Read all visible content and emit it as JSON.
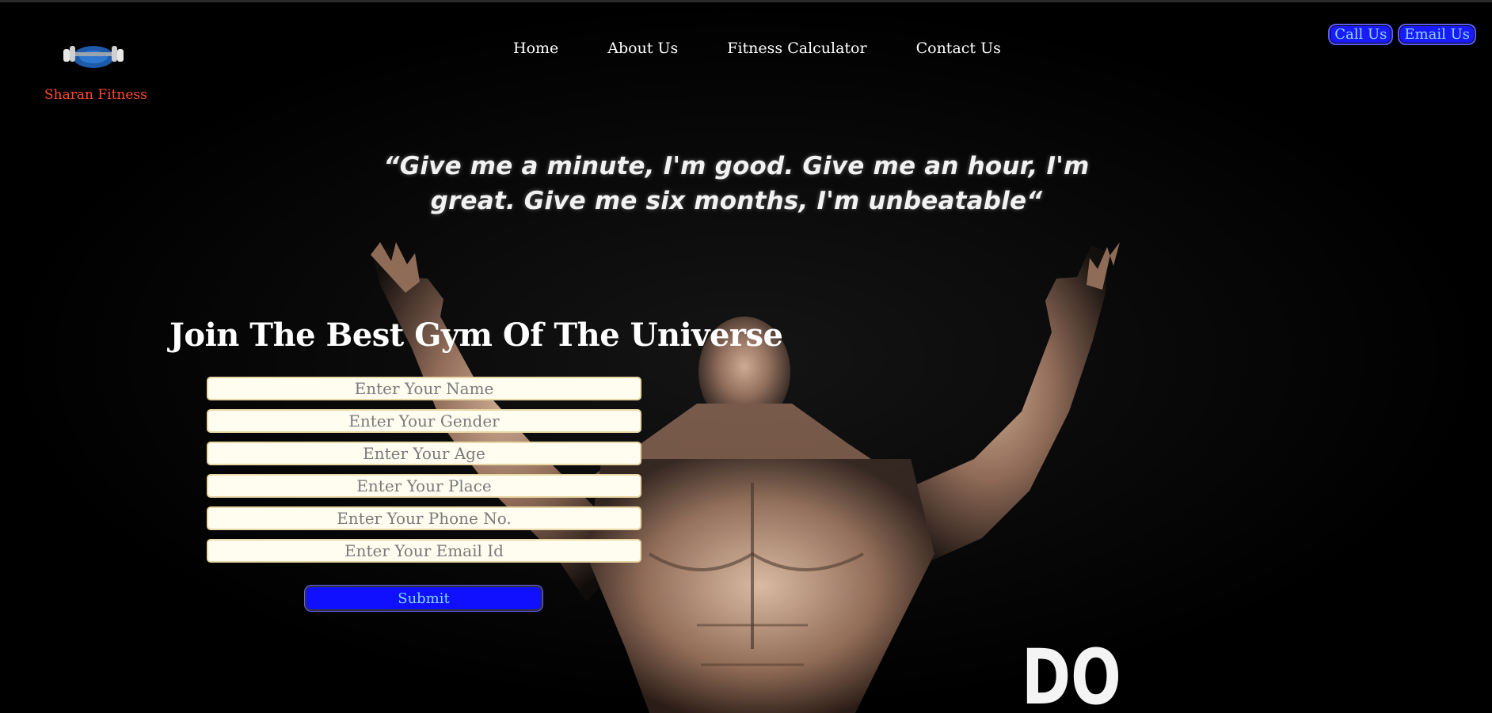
{
  "brand": {
    "name": "Sharan Fitness",
    "logo_icon": "dumbbell-logo-icon"
  },
  "nav": {
    "items": [
      "Home",
      "About Us",
      "Fitness Calculator",
      "Contact Us"
    ]
  },
  "contact": {
    "call_label": "Call Us",
    "email_label": "Email Us"
  },
  "hero": {
    "quote_line1": "“Give me a minute, I'm good. Give me an hour, I'm",
    "quote_line2": "great. Give me six months, I'm unbeatable“",
    "bottom_text": "DO"
  },
  "form": {
    "title": "Join The Best Gym Of The Universe",
    "name_placeholder": "Enter Your Name",
    "gender_placeholder": "Enter Your Gender",
    "age_placeholder": "Enter Your Age",
    "place_placeholder": "Enter Your Place",
    "phone_placeholder": "Enter Your Phone No.",
    "email_placeholder": "Enter Your Email Id",
    "submit_label": "Submit"
  },
  "colors": {
    "background": "#000000",
    "brand": "#ff4a2e",
    "button": "#1010ff",
    "button_text": "#7fd8ff"
  }
}
